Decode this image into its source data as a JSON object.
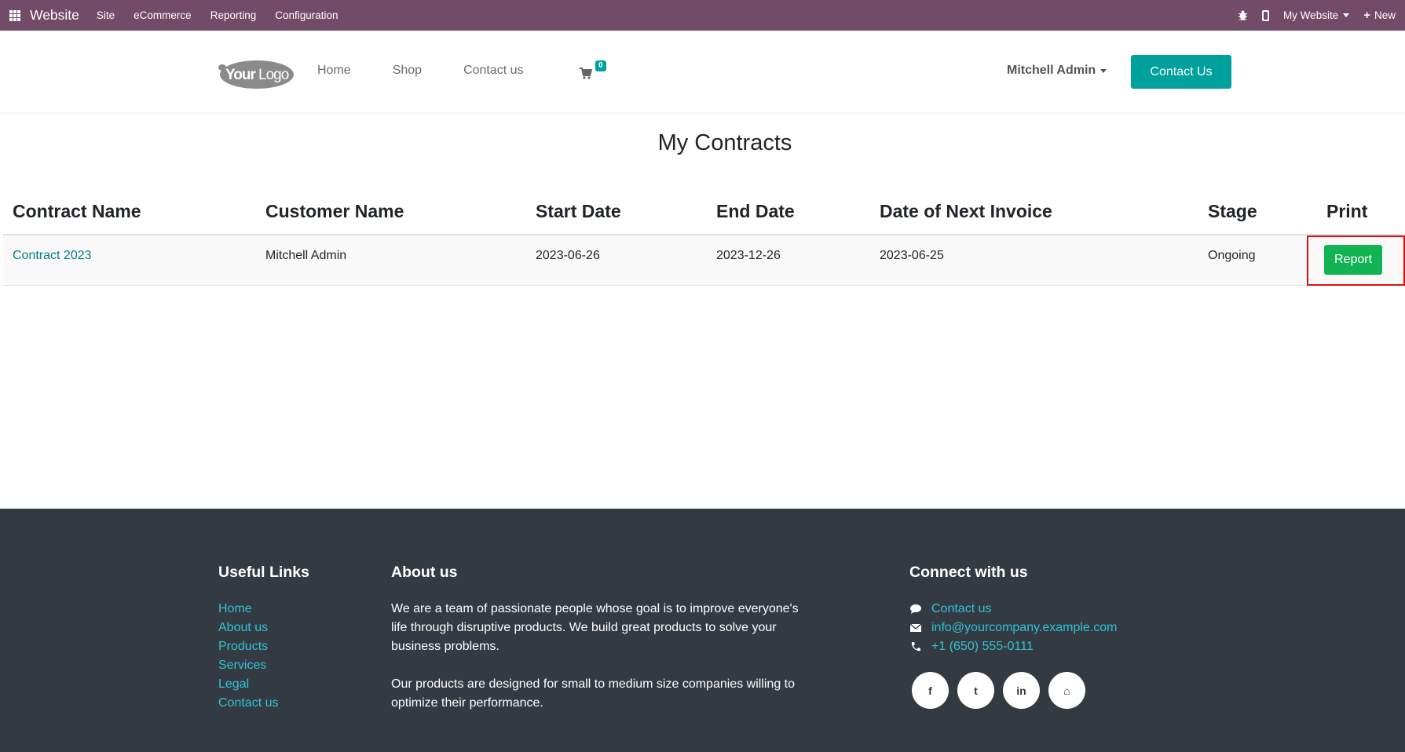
{
  "adminbar": {
    "brand": "Website",
    "menu": [
      "Site",
      "eCommerce",
      "Reporting",
      "Configuration"
    ],
    "website_selector": "My Website",
    "new_label": "New",
    "color": "#714b67"
  },
  "header": {
    "nav": [
      "Home",
      "Shop",
      "Contact us"
    ],
    "cart_count": "0",
    "user": "Mitchell Admin",
    "contact_button": "Contact Us",
    "accent": "#00a09d"
  },
  "main": {
    "title": "My Contracts",
    "columns": [
      "Contract Name",
      "Customer Name",
      "Start Date",
      "End Date",
      "Date of Next Invoice",
      "Stage",
      "Print"
    ],
    "rows": [
      {
        "contract_name": "Contract 2023",
        "customer_name": "Mitchell Admin",
        "start_date": "2023-06-26",
        "end_date": "2023-12-26",
        "next_invoice": "2023-06-25",
        "stage": "Ongoing",
        "print_label": "Report"
      }
    ]
  },
  "footer": {
    "useful_links_title": "Useful Links",
    "useful_links": [
      "Home",
      "About us",
      "Products",
      "Services",
      "Legal",
      "Contact us"
    ],
    "about_title": "About us",
    "about_paragraphs": [
      "We are a team of passionate people whose goal is to improve everyone's life through disruptive products. We build great products to solve your business problems.",
      "Our products are designed for small to medium size companies willing to optimize their performance."
    ],
    "connect_title": "Connect with us",
    "connect_items": [
      {
        "icon": "comment-icon",
        "text": "Contact us"
      },
      {
        "icon": "envelope-icon",
        "text": "info@yourcompany.example.com"
      },
      {
        "icon": "phone-icon",
        "text": "+1 (650) 555-0111"
      }
    ],
    "social": [
      {
        "icon": "facebook-icon",
        "glyph": "f"
      },
      {
        "icon": "twitter-icon",
        "glyph": "t"
      },
      {
        "icon": "linkedin-icon",
        "glyph": "in"
      },
      {
        "icon": "home-icon",
        "glyph": "⌂"
      }
    ]
  }
}
